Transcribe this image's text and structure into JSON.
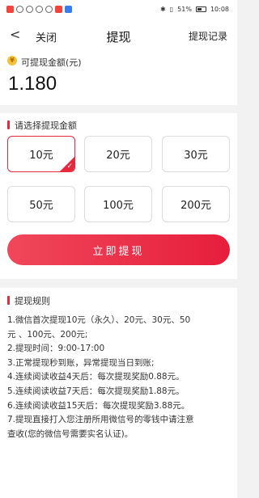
{
  "status_bar": {
    "left_icons": [
      "red-app-icon",
      "signal-icon",
      "wifi-icon",
      "eye-icon",
      "target-icon",
      "red-app-icon-2",
      "blue-app-icon"
    ],
    "battery": "51%",
    "time": "10:08"
  },
  "nav": {
    "back_icon": "chevron-left-icon",
    "close_label": "关闭",
    "title": "提现",
    "record_label": "提现记录"
  },
  "balance": {
    "label": "可提现金额(元)",
    "amount": "1.180",
    "coin_symbol": "¥"
  },
  "amounts": {
    "title": "请选择提现金额",
    "options": [
      "10元",
      "20元",
      "30元",
      "50元",
      "100元",
      "200元"
    ],
    "selected": "10元"
  },
  "withdraw_button": {
    "label": "立即提现"
  },
  "rules": {
    "title": "提现规则",
    "lines": [
      "1.微信首次提现10元（永久）、20元、30元、50",
      "元 、100元、200元;",
      "2.提现时间：9:00-17:00",
      "3.正常提现秒到账，异常提现当日到账;",
      "4.连续阅读收益4天后：每次提现奖励0.88元。",
      "5.连续阅读收益7天后：每次提现奖励1.88元。",
      "6.连续阅读收益15天后：每次提现奖励3.88元。",
      "7.提现直接打入您注册所用微信号的零钱中请注意",
      "查收(您的微信号需要实名认证)。"
    ]
  },
  "colors": {
    "accent": "#e8283c",
    "background": "#f2f2f2",
    "coin": "#f5c13b"
  }
}
